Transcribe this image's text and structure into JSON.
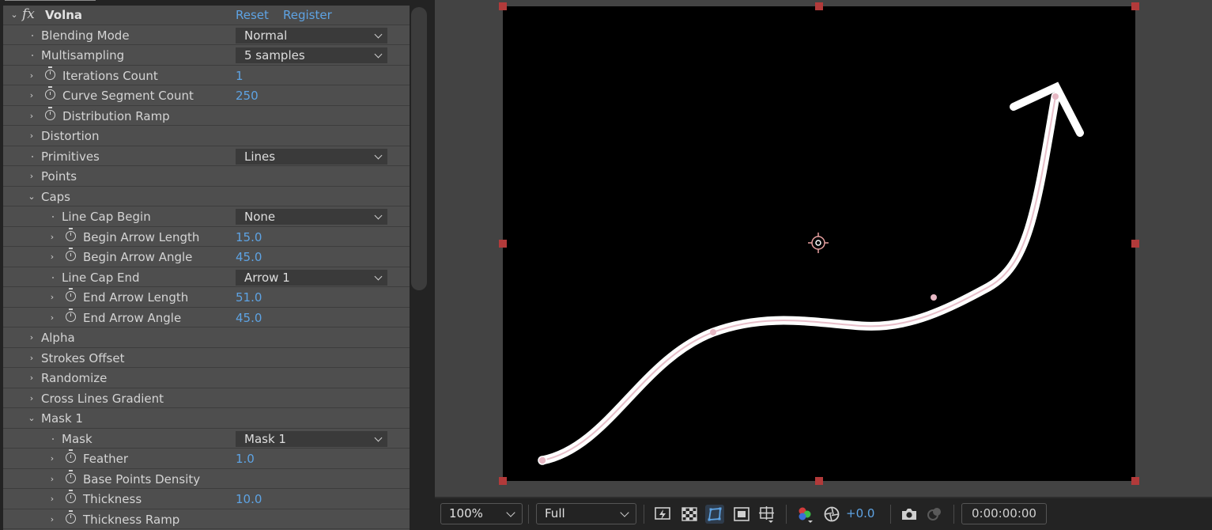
{
  "effect": {
    "fx_symbol": "fx",
    "name": "Volna",
    "reset_label": "Reset",
    "register_label": "Register"
  },
  "rows": [
    {
      "label": "Blending Mode",
      "dropdown": "Normal"
    },
    {
      "label": "Multisampling",
      "dropdown": "5 samples"
    },
    {
      "label": "Iterations Count",
      "value": "1"
    },
    {
      "label": "Curve Segment Count",
      "value": "250"
    },
    {
      "label": "Distribution Ramp"
    },
    {
      "label": "Distortion"
    },
    {
      "label": "Primitives",
      "dropdown": "Lines"
    },
    {
      "label": "Points"
    },
    {
      "label": "Caps"
    },
    {
      "label": "Line Cap Begin",
      "dropdown": "None"
    },
    {
      "label": "Begin Arrow Length",
      "value": "15.0"
    },
    {
      "label": "Begin Arrow Angle",
      "value": "45.0"
    },
    {
      "label": "Line Cap End",
      "dropdown": "Arrow 1"
    },
    {
      "label": "End Arrow Length",
      "value": "51.0"
    },
    {
      "label": "End Arrow Angle",
      "value": "45.0"
    },
    {
      "label": "Alpha"
    },
    {
      "label": "Strokes Offset"
    },
    {
      "label": "Randomize"
    },
    {
      "label": "Cross Lines Gradient"
    },
    {
      "label": "Mask 1"
    },
    {
      "label": "Mask",
      "dropdown": "Mask 1"
    },
    {
      "label": "Feather",
      "value": "1.0"
    },
    {
      "label": "Base Points Density"
    },
    {
      "label": "Thickness",
      "value": "10.0"
    },
    {
      "label": "Thickness Ramp"
    }
  ],
  "viewer": {
    "zoom": "100%",
    "resolution": "Full",
    "exposure": "+0.0",
    "timecode": "0:00:00:00"
  },
  "colors": {
    "value_blue": "#5ea3e3",
    "handle_red": "#b23a3a",
    "stroke_white": "#ffffff",
    "stroke_pink": "#e6b8c4"
  }
}
